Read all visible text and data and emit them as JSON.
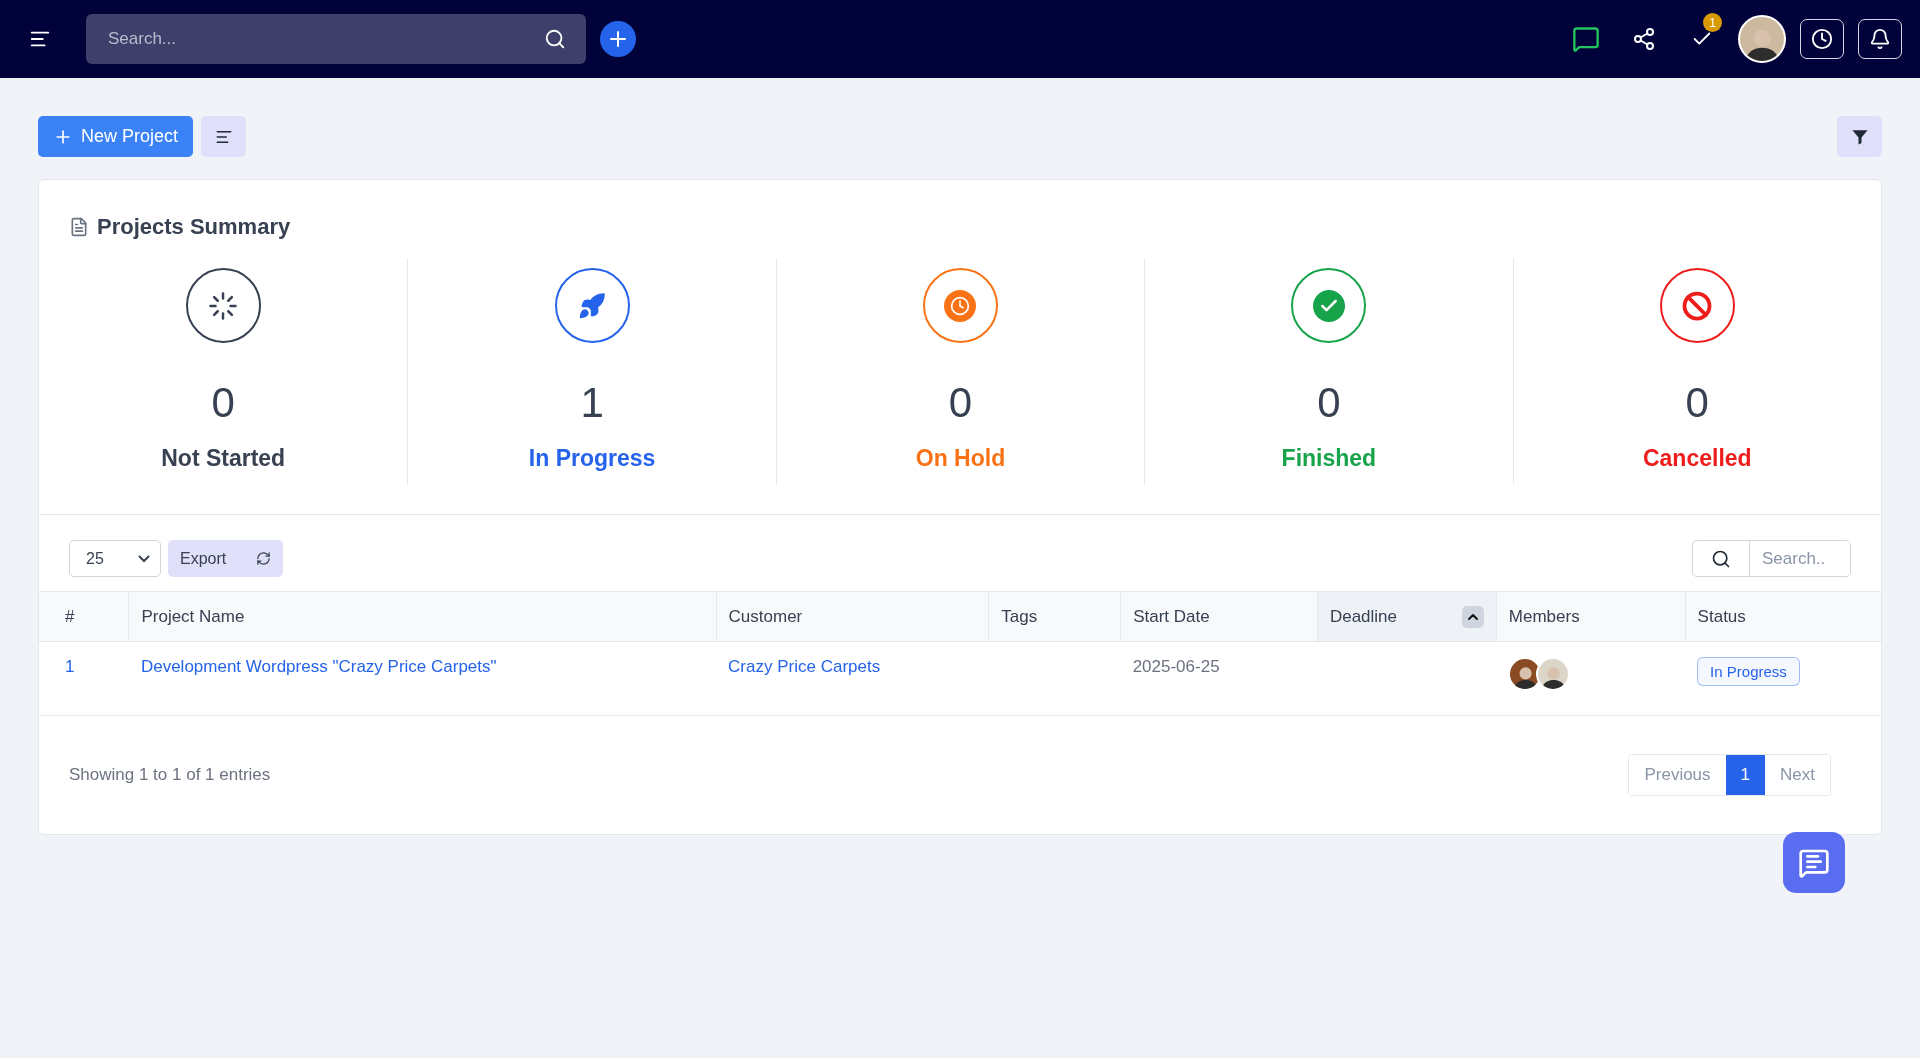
{
  "topbar": {
    "search": {
      "placeholder": "Search..."
    },
    "tasks_badge": "1"
  },
  "toolbar": {
    "new_project": "New Project"
  },
  "summary": {
    "title": "Projects Summary",
    "stats": [
      {
        "kind": "not_started",
        "count": "0",
        "label": "Not Started"
      },
      {
        "kind": "in_progress",
        "count": "1",
        "label": "In Progress"
      },
      {
        "kind": "on_hold",
        "count": "0",
        "label": "On Hold"
      },
      {
        "kind": "finished",
        "count": "0",
        "label": "Finished"
      },
      {
        "kind": "cancelled",
        "count": "0",
        "label": "Cancelled"
      }
    ]
  },
  "table": {
    "page_size": "25",
    "export": "Export",
    "search": {
      "placeholder": "Search.."
    },
    "columns": [
      {
        "label": "#",
        "sorted": false
      },
      {
        "label": "Project Name",
        "sorted": false
      },
      {
        "label": "Customer",
        "sorted": false
      },
      {
        "label": "Tags",
        "sorted": false
      },
      {
        "label": "Start Date",
        "sorted": false
      },
      {
        "label": "Deadline",
        "sorted": true
      },
      {
        "label": "Members",
        "sorted": false
      },
      {
        "label": "Status",
        "sorted": false
      }
    ],
    "rows": [
      {
        "number": "1",
        "project_name": "Development Wordpress \"Crazy Price Carpets\"",
        "customer": "Crazy Price Carpets",
        "start_date": "2025-06-25",
        "status": {
          "kind": "in_progress",
          "label": "In Progress"
        }
      }
    ],
    "info": "Showing 1 to 1 of 1 entries",
    "pagination": {
      "previous": "Previous",
      "pages": [
        {
          "label": "1",
          "selected": true
        }
      ],
      "next": "Next"
    }
  }
}
